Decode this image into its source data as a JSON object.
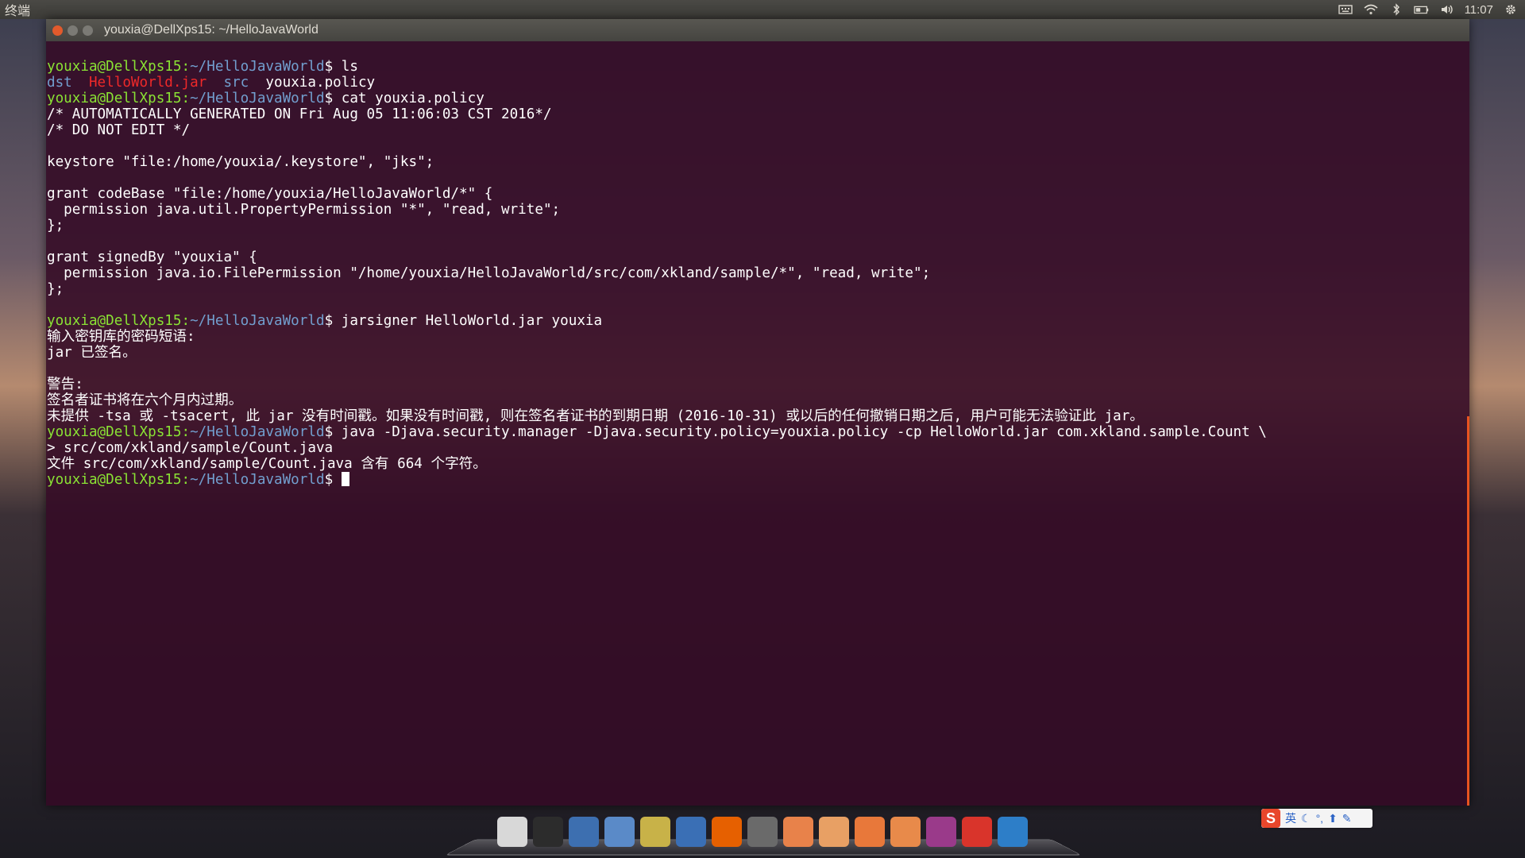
{
  "top_panel": {
    "app_title": "终端",
    "clock": "11:07",
    "indicators": [
      "keyboard-icon",
      "wifi-icon",
      "bluetooth-icon",
      "battery-icon",
      "volume-icon",
      "gear-icon"
    ]
  },
  "window": {
    "title": "youxia@DellXps15: ~/HelloJavaWorld"
  },
  "terminal": {
    "prompt_user": "youxia@DellXps15:",
    "prompt_path": "~/HelloJavaWorld",
    "cmd_ls": "$ ls",
    "ls_dst": "dst",
    "ls_jar": "HelloWorld.jar",
    "ls_src": "src",
    "ls_policy": "youxia.policy",
    "cmd_cat": "$ cat youxia.policy",
    "policy_lines": [
      "/* AUTOMATICALLY GENERATED ON Fri Aug 05 11:06:03 CST 2016*/",
      "/* DO NOT EDIT */",
      "",
      "keystore \"file:/home/youxia/.keystore\", \"jks\";",
      "",
      "grant codeBase \"file:/home/youxia/HelloJavaWorld/*\" {",
      "  permission java.util.PropertyPermission \"*\", \"read, write\";",
      "};",
      "",
      "grant signedBy \"youxia\" {",
      "  permission java.io.FilePermission \"/home/youxia/HelloJavaWorld/src/com/xkland/sample/*\", \"read, write\";",
      "};",
      ""
    ],
    "cmd_jarsigner": "$ jarsigner HelloWorld.jar youxia",
    "jarsigner_output": [
      "输入密钥库的密码短语:",
      "jar 已签名。",
      "",
      "警告:",
      "签名者证书将在六个月内过期。",
      "未提供 -tsa 或 -tsacert, 此 jar 没有时间戳。如果没有时间戳, 则在签名者证书的到期日期 (2016-10-31) 或以后的任何撤销日期之后, 用户可能无法验证此 jar。"
    ],
    "cmd_java": "$ java -Djava.security.manager -Djava.security.policy=youxia.policy -cp HelloWorld.jar com.xkland.sample.Count \\",
    "continuation": "> src/com/xkland/sample/Count.java",
    "java_output": "文件 src/com/xkland/sample/Count.java 含有 664 个字符。",
    "final_prompt_suffix": "$ "
  },
  "dock": {
    "items": [
      {
        "name": "system-settings-icon",
        "color": "#d8d8d8"
      },
      {
        "name": "terminal-icon",
        "color": "#2c2c2c"
      },
      {
        "name": "screenshot-icon",
        "color": "#3d6fb0"
      },
      {
        "name": "text-editor-icon",
        "color": "#5a8ac8"
      },
      {
        "name": "image-viewer-icon",
        "color": "#c8b248"
      },
      {
        "name": "thunderbird-icon",
        "color": "#3a6fb5"
      },
      {
        "name": "firefox-icon",
        "color": "#e66000"
      },
      {
        "name": "archive-icon",
        "color": "#6a6a6a"
      },
      {
        "name": "home-folder-icon",
        "color": "#e8824a"
      },
      {
        "name": "documents-folder-icon",
        "color": "#e8a064"
      },
      {
        "name": "recent-folder-icon",
        "color": "#e8783a"
      },
      {
        "name": "downloads-folder-icon",
        "color": "#e88a4a"
      },
      {
        "name": "workspace-switcher-icon",
        "color": "#9a3a8a"
      },
      {
        "name": "power-icon",
        "color": "#d9342b"
      },
      {
        "name": "accessibility-icon",
        "color": "#2d7ec8"
      }
    ]
  },
  "ime": {
    "logo": "S",
    "mode": "英"
  }
}
